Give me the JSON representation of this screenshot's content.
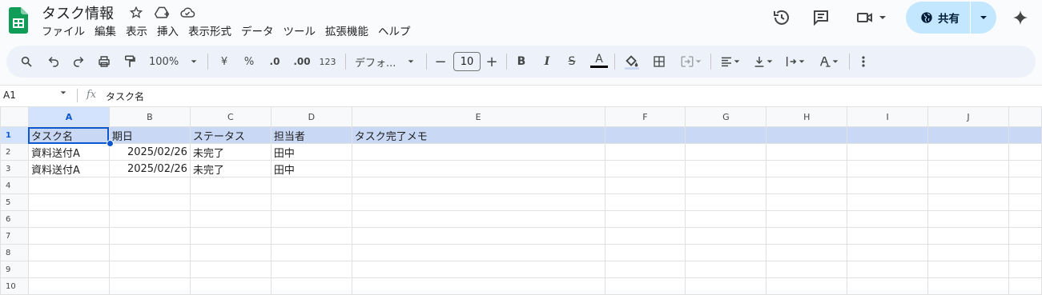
{
  "doc": {
    "title": "タスク情報"
  },
  "menu": [
    "ファイル",
    "編集",
    "表示",
    "挿入",
    "表示形式",
    "データ",
    "ツール",
    "拡張機能",
    "ヘルプ"
  ],
  "share": {
    "label": "共有"
  },
  "toolbar": {
    "zoom": "100%",
    "currency": "¥",
    "percent": "%",
    "dec_decrease": ".0",
    "dec_increase": ".00",
    "number_format": "123",
    "font": "デフォ...",
    "font_size": "10",
    "minus": "−",
    "plus": "+",
    "bold": "B",
    "italic": "I",
    "strike": "S",
    "text_color": "A"
  },
  "formula_bar": {
    "cell_ref": "A1",
    "content": "タスク名"
  },
  "grid": {
    "columns": [
      "A",
      "B",
      "C",
      "D",
      "E",
      "F",
      "G",
      "H",
      "I",
      "J"
    ],
    "rows": [
      {
        "num": "1",
        "cells": [
          "タスク名",
          "期日",
          "ステータス",
          "担当者",
          "タスク完了メモ",
          "",
          "",
          "",
          "",
          ""
        ]
      },
      {
        "num": "2",
        "cells": [
          "資料送付A",
          "2025/02/26",
          "未完了",
          "田中",
          "",
          "",
          "",
          "",
          "",
          ""
        ]
      },
      {
        "num": "3",
        "cells": [
          "資料送付A",
          "2025/02/26",
          "未完了",
          "田中",
          "",
          "",
          "",
          "",
          "",
          ""
        ]
      },
      {
        "num": "4",
        "cells": [
          "",
          "",
          "",
          "",
          "",
          "",
          "",
          "",
          "",
          ""
        ]
      },
      {
        "num": "5",
        "cells": [
          "",
          "",
          "",
          "",
          "",
          "",
          "",
          "",
          "",
          ""
        ]
      },
      {
        "num": "6",
        "cells": [
          "",
          "",
          "",
          "",
          "",
          "",
          "",
          "",
          "",
          ""
        ]
      },
      {
        "num": "7",
        "cells": [
          "",
          "",
          "",
          "",
          "",
          "",
          "",
          "",
          "",
          ""
        ]
      },
      {
        "num": "8",
        "cells": [
          "",
          "",
          "",
          "",
          "",
          "",
          "",
          "",
          "",
          ""
        ]
      },
      {
        "num": "9",
        "cells": [
          "",
          "",
          "",
          "",
          "",
          "",
          "",
          "",
          "",
          ""
        ]
      },
      {
        "num": "10",
        "cells": [
          "",
          "",
          "",
          "",
          "",
          "",
          "",
          "",
          "",
          ""
        ]
      }
    ]
  },
  "colors": {
    "accent": "#0b57d0",
    "header_fill": "#c9d8f5",
    "share_bg": "#c2e7ff",
    "sheets_green": "#0f9d58"
  }
}
